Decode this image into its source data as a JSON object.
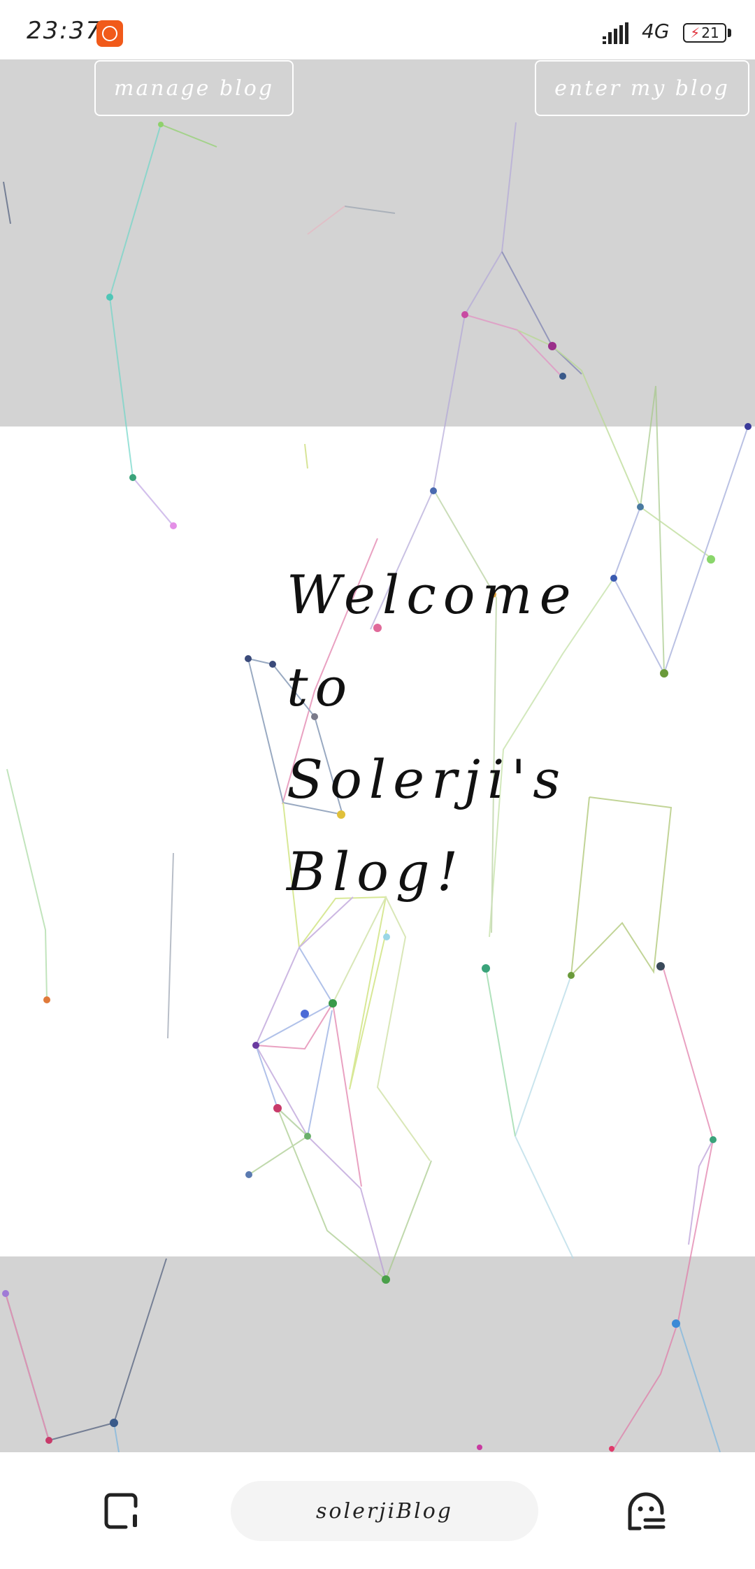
{
  "status_bar": {
    "time": "23:37",
    "network": "4G",
    "battery": "21",
    "icons": [
      "app-notification-icon",
      "signal-icon",
      "battery-charging-icon"
    ]
  },
  "header": {
    "manage_label": "manage blog",
    "enter_label": "enter my blog"
  },
  "hero": {
    "line1": "Welcome",
    "line2": "to",
    "line3": "Solerji's",
    "line4": "Blog!"
  },
  "bottom_bar": {
    "url_label": "solerjiBlog",
    "icons": [
      "tabs-icon",
      "assistant-face-icon"
    ]
  },
  "colors": {
    "band_gray": "#d3d3d3",
    "button_border": "#ffffff",
    "badge_orange": "#f15a1a"
  }
}
